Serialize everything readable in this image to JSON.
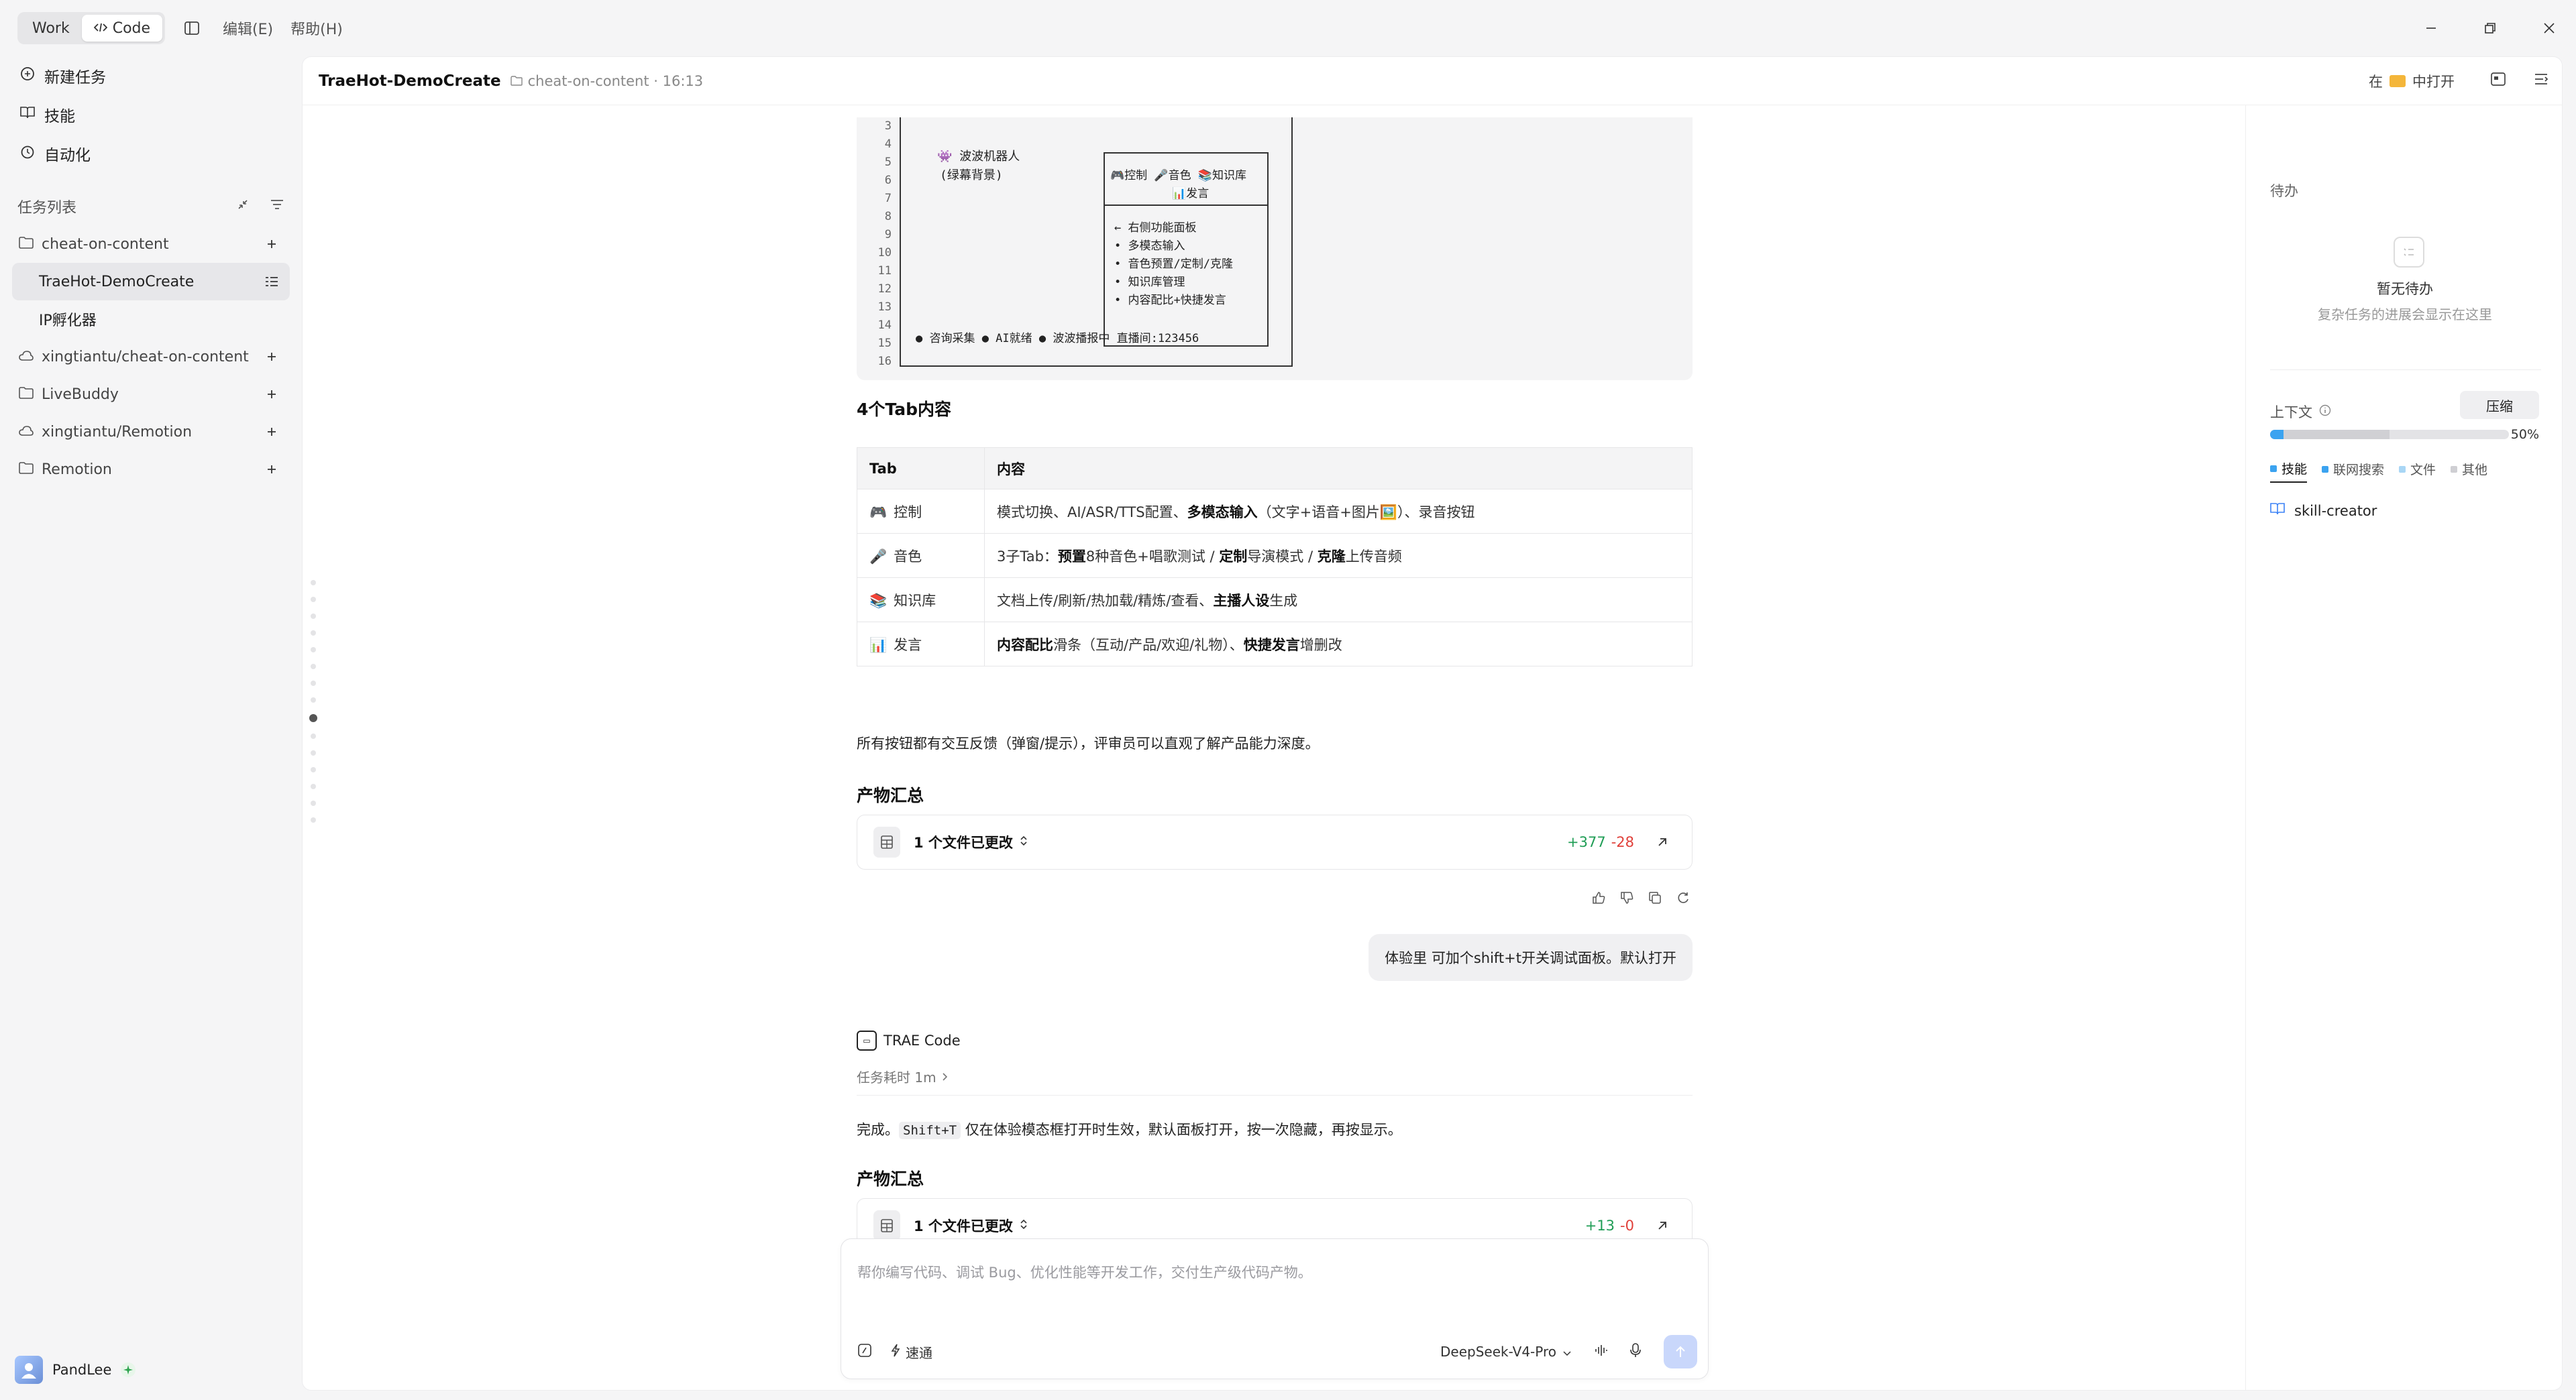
{
  "titlebar": {
    "mode_work": "Work",
    "mode_code": "Code",
    "menu_edit": "编辑(E)",
    "menu_help": "帮助(H)"
  },
  "sidebar": {
    "nav": [
      {
        "label": "新建任务",
        "icon": "new-task-icon"
      },
      {
        "label": "技能",
        "icon": "book-icon"
      },
      {
        "label": "自动化",
        "icon": "clock-icon"
      }
    ],
    "task_list_label": "任务列表",
    "tree": [
      {
        "label": "cheat-on-content",
        "icon": "folder-icon",
        "type": "folder"
      },
      {
        "label": "TraeHot-DemoCreate",
        "type": "child",
        "selected": true
      },
      {
        "label": "IP孵化器",
        "type": "child"
      },
      {
        "label": "xingtiantu/cheat-on-content",
        "icon": "cloud-icon",
        "type": "folder"
      },
      {
        "label": "LiveBuddy",
        "icon": "folder-icon",
        "type": "folder"
      },
      {
        "label": "xingtiantu/Remotion",
        "icon": "cloud-icon",
        "type": "folder"
      },
      {
        "label": "Remotion",
        "icon": "folder-icon",
        "type": "folder"
      }
    ],
    "user_name": "PandLee"
  },
  "header": {
    "title": "TraeHot-DemoCreate",
    "crumb": "cheat-on-content · 16:13",
    "open_prefix": "在",
    "open_suffix": "中打开"
  },
  "code_block": {
    "line_numbers": [
      "3",
      "4",
      "5",
      "6",
      "7",
      "8",
      "9",
      "10",
      "11",
      "12",
      "13",
      "14",
      "15",
      "16"
    ],
    "robot_label": "👾 波波机器人",
    "robot_bg": "(绿幕背景)",
    "tabs_line": "🎮控制 🎤音色 📚知识库",
    "tabs_line2": "📊发言",
    "menu_items": [
      "← 右侧功能面板",
      "• 多模态输入",
      "• 音色预置/定制/克隆",
      "• 知识库管理",
      "• 内容配比+快捷发言"
    ],
    "status_line": "● 咨询采集 ● AI就绪 ● 波波播报中    直播间:123456"
  },
  "section_tabs": {
    "heading": "4个Tab内容",
    "col_tab": "Tab",
    "col_content": "内容",
    "rows": [
      {
        "emoji": "🎮",
        "tab": "控制",
        "pre": "模式切换、AI/ASR/TTS配置、",
        "bold": "多模态输入",
        "post": "（文字+语音+图片🖼️）、录音按钮"
      },
      {
        "emoji": "🎤",
        "tab": "音色",
        "pre": "3子Tab：",
        "bold": "预置",
        "post": "8种音色+唱歌测试 / ",
        "bold2": "定制",
        "post2": "导演模式 / ",
        "bold3": "克隆",
        "post3": "上传音频"
      },
      {
        "emoji": "📚",
        "tab": "知识库",
        "pre": "文档上传/刷新/热加载/精炼/查看、",
        "bold": "主播人设",
        "post": "生成"
      },
      {
        "emoji": "📊",
        "tab": "发言",
        "pre": "",
        "bold": "内容配比",
        "post": "滑条（互动/产品/欢迎/礼物）、",
        "bold2": "快捷发言",
        "post2": "增删改"
      }
    ],
    "note": "所有按钮都有交互反馈（弹窗/提示），评审员可以直观了解产品能力深度。"
  },
  "artifacts_1": {
    "heading": "产物汇总",
    "label": "1 个文件已更改",
    "add": "+377",
    "del": "-28"
  },
  "user_message": "体验里 可加个shift+t开关调试面板。默认打开",
  "agent": {
    "name": "TRAE Code",
    "task_time": "任务耗时 1m",
    "reply_pre": "完成。",
    "reply_code": "Shift+T",
    "reply_post": " 仅在体验模态框打开时生效，默认面板打开，按一次隐藏，再按显示。"
  },
  "artifacts_2": {
    "heading": "产物汇总",
    "label": "1 个文件已更改",
    "add": "+13",
    "del": "-0"
  },
  "composer": {
    "placeholder": "帮你编写代码、调试 Bug、优化性能等开发工作，交付生产级代码产物。",
    "speed_label": "速通",
    "model": "DeepSeek-V4-Pro"
  },
  "right_panel": {
    "todo_title": "待办",
    "empty_title": "暂无待办",
    "empty_sub": "复杂任务的进展会显示在这里",
    "context_label": "上下文",
    "compress": "压缩",
    "context_percent": "50%",
    "context_fraction": 0.5,
    "legend": [
      {
        "label": "技能",
        "color": "#3ba3f0",
        "active": true
      },
      {
        "label": "联网搜索",
        "color": "#3ba3f0"
      },
      {
        "label": "文件",
        "color": "#a9d6f5"
      },
      {
        "label": "其他",
        "color": "#cfcfd3"
      }
    ],
    "skill": "skill-creator"
  }
}
